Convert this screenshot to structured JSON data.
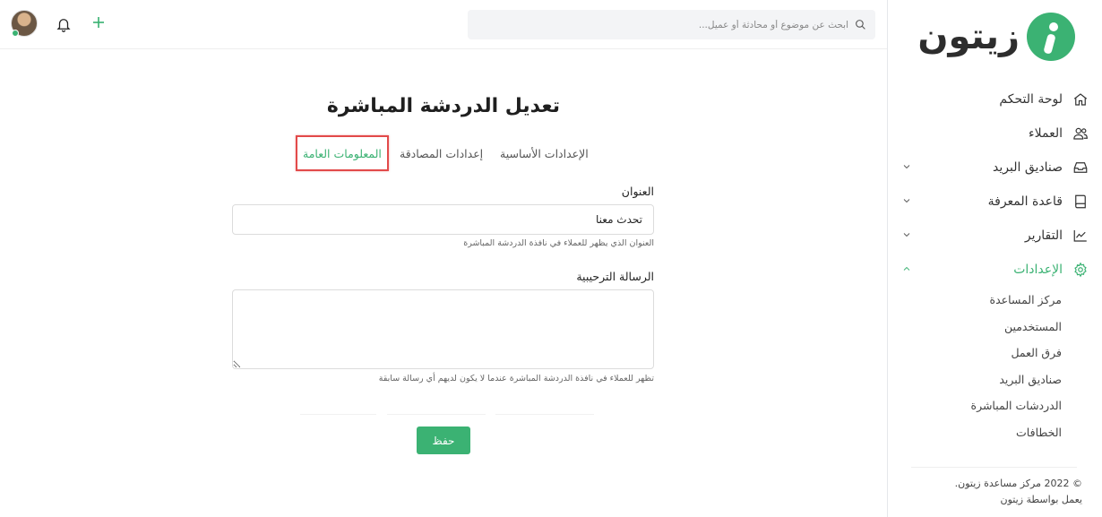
{
  "brand": {
    "name": "زيتون",
    "color": "#3bb273"
  },
  "topbar": {
    "search_placeholder": "ابحث عن موضوع أو محادثة أو عميل...",
    "icons": [
      "search-icon",
      "bell-icon",
      "plus-icon",
      "avatar"
    ]
  },
  "sidebar": {
    "items": [
      {
        "label": "لوحة التحكم",
        "icon": "home-icon",
        "expandable": false
      },
      {
        "label": "العملاء",
        "icon": "users-icon",
        "expandable": false
      },
      {
        "label": "صناديق البريد",
        "icon": "inbox-icon",
        "expandable": true
      },
      {
        "label": "قاعدة المعرفة",
        "icon": "book-icon",
        "expandable": true
      },
      {
        "label": "التقارير",
        "icon": "chart-icon",
        "expandable": true
      },
      {
        "label": "الإعدادات",
        "icon": "gear-icon",
        "expandable": true,
        "active": true
      }
    ],
    "settings_sub": [
      "مركز المساعدة",
      "المستخدمين",
      "فرق العمل",
      "صناديق البريد",
      "الدردشات المباشرة",
      "الخطافات"
    ],
    "footer_line1": "© 2022 مركز مساعدة زيتون.",
    "footer_line2": "يعمل بواسطة زيتون"
  },
  "main": {
    "title": "تعديل الدردشة المباشرة",
    "tabs": [
      "الإعدادات الأساسية",
      "إعدادات المصادقة",
      "المعلومات العامة"
    ],
    "active_tab": "المعلومات العامة",
    "fields": {
      "title_label": "العنوان",
      "title_value": "تحدث معنا",
      "title_help": "العنوان الذي يظهر للعملاء في نافذة الدردشة المباشرة",
      "welcome_label": "الرسالة الترحيبية",
      "welcome_value": "",
      "welcome_help": "تظهر للعملاء في نافذة الدردشة المباشرة عندما لا يكون لديهم أي رسالة سابقة"
    },
    "save_label": "حفظ"
  }
}
